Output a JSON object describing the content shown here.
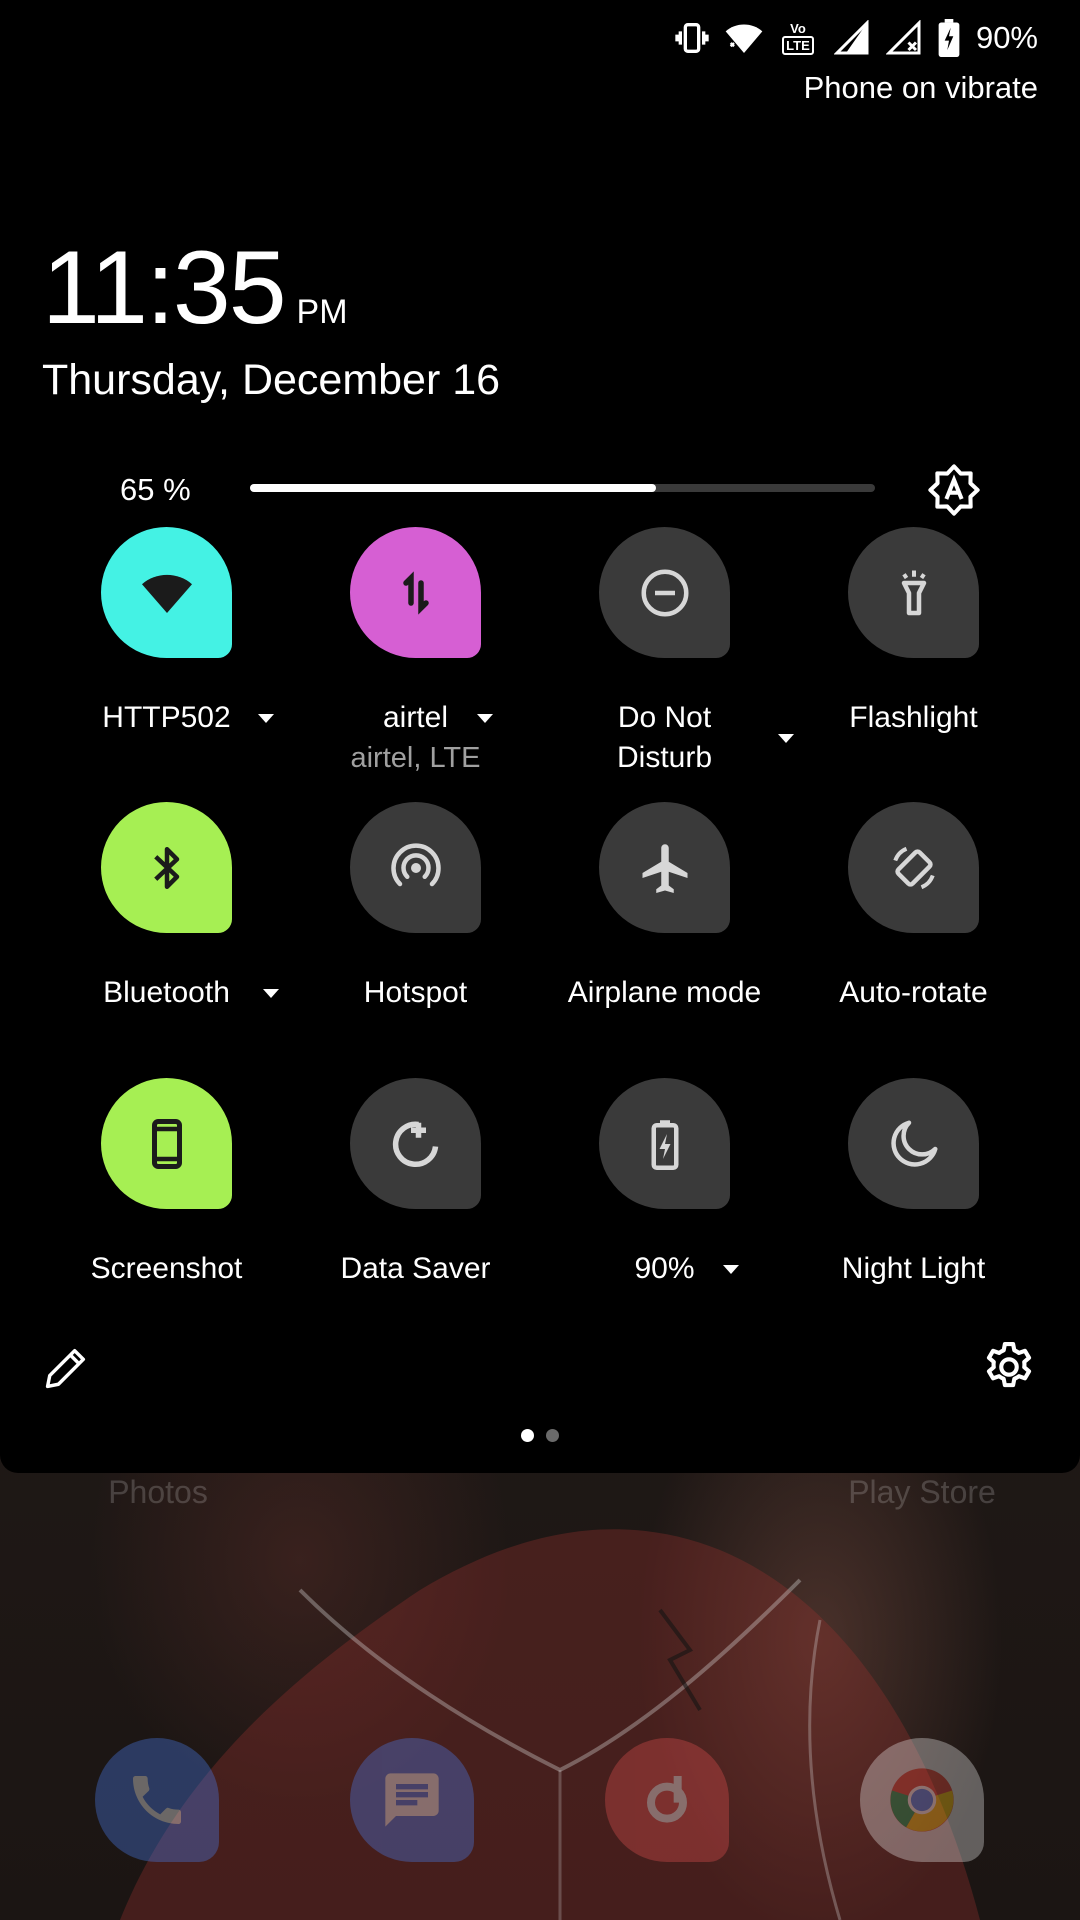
{
  "status_bar": {
    "battery_percent": "90%",
    "icons": [
      "vibrate-icon",
      "wifi-icon",
      "volte-icon",
      "cell-signal-icon",
      "cell-signal-no-data-icon",
      "battery-charging-icon"
    ],
    "volte_text_top": "Vo",
    "volte_text_bottom": "LTE"
  },
  "header": {
    "ringer_status": "Phone on vibrate",
    "time": "11:35",
    "ampm": "PM",
    "date": "Thursday, December 16"
  },
  "brightness": {
    "label": "65 %",
    "level_percent": 65,
    "auto_icon": "auto-brightness-icon"
  },
  "tiles": [
    {
      "id": "wifi",
      "label": "HTTP502",
      "sub": "",
      "icon": "wifi-icon",
      "active": true,
      "color": "#44f2e4",
      "has_dropdown": true
    },
    {
      "id": "mobile-data",
      "label": "airtel",
      "sub": "airtel, LTE",
      "icon": "mobile-data-icon",
      "active": true,
      "color": "#d65fd3",
      "has_dropdown": true
    },
    {
      "id": "dnd",
      "label": "Do Not Disturb",
      "sub": "",
      "icon": "dnd-icon",
      "active": false,
      "color": "#3a3a3a",
      "has_dropdown": true
    },
    {
      "id": "flashlight",
      "label": "Flashlight",
      "sub": "",
      "icon": "flashlight-icon",
      "active": false,
      "color": "#3a3a3a",
      "has_dropdown": false
    },
    {
      "id": "bluetooth",
      "label": "Bluetooth",
      "sub": "",
      "icon": "bluetooth-icon",
      "active": true,
      "color": "#a6ef53",
      "has_dropdown": true
    },
    {
      "id": "hotspot",
      "label": "Hotspot",
      "sub": "",
      "icon": "hotspot-icon",
      "active": false,
      "color": "#3a3a3a",
      "has_dropdown": false
    },
    {
      "id": "airplane",
      "label": "Airplane mode",
      "sub": "",
      "icon": "airplane-icon",
      "active": false,
      "color": "#3a3a3a",
      "has_dropdown": false
    },
    {
      "id": "auto-rotate",
      "label": "Auto-rotate",
      "sub": "",
      "icon": "auto-rotate-icon",
      "active": false,
      "color": "#3a3a3a",
      "has_dropdown": false
    },
    {
      "id": "screenshot",
      "label": "Screenshot",
      "sub": "",
      "icon": "screenshot-icon",
      "active": true,
      "color": "#a6ef53",
      "has_dropdown": false
    },
    {
      "id": "data-saver",
      "label": "Data Saver",
      "sub": "",
      "icon": "data-saver-icon",
      "active": false,
      "color": "#3a3a3a",
      "has_dropdown": false
    },
    {
      "id": "battery-saver",
      "label": "90%",
      "sub": "",
      "icon": "battery-icon",
      "active": false,
      "color": "#3a3a3a",
      "has_dropdown": true
    },
    {
      "id": "night-light",
      "label": "Night Light",
      "sub": "",
      "icon": "night-light-icon",
      "active": false,
      "color": "#3a3a3a",
      "has_dropdown": false
    }
  ],
  "footer": {
    "edit_icon": "pencil-icon",
    "settings_icon": "gear-icon",
    "page_count": 2,
    "active_page": 1
  },
  "home_screen": {
    "labels": [
      "Photos",
      "Play Store"
    ],
    "dock": [
      "phone-icon",
      "messages-icon",
      "music-icon",
      "chrome-icon"
    ]
  }
}
